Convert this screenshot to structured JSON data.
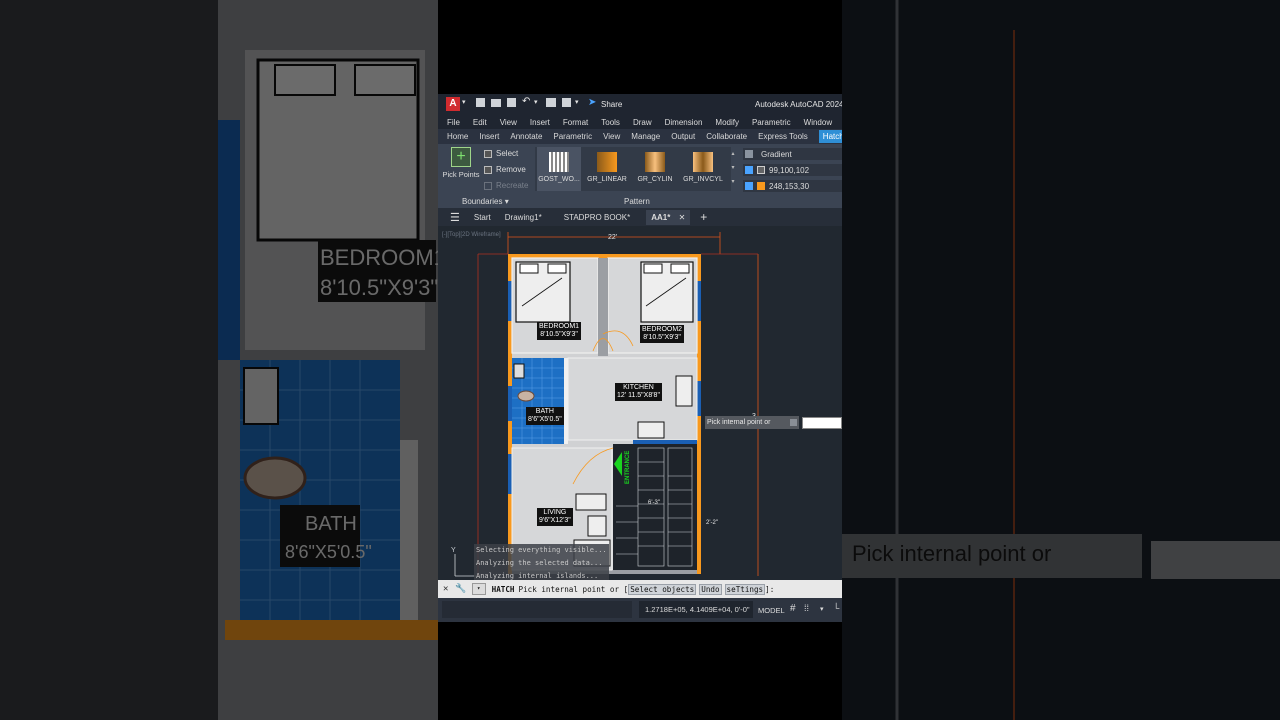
{
  "app": {
    "title": "Autodesk AutoCAD 2024",
    "logo_letter": "A",
    "share_label": "Share"
  },
  "menu": [
    "File",
    "Edit",
    "View",
    "Insert",
    "Format",
    "Tools",
    "Draw",
    "Dimension",
    "Modify",
    "Parametric",
    "Window"
  ],
  "ribbon_tabs": [
    "Home",
    "Insert",
    "Annotate",
    "Parametric",
    "View",
    "Manage",
    "Output",
    "Collaborate",
    "Express Tools"
  ],
  "ribbon_tab_active": "Hatch",
  "ribbon": {
    "pick_points": "Pick Points",
    "select": "Select",
    "remove": "Remove",
    "recreate": "Recreate",
    "boundaries": "Boundaries",
    "patterns": [
      "GOST_WO...",
      "GR_LINEAR",
      "GR_CYLIN",
      "GR_INVCYL"
    ],
    "pattern_label": "Pattern",
    "gradient": "Gradient",
    "color1": "99,100,102",
    "color2": "248,153,30"
  },
  "doc_tabs": [
    "Start",
    "Drawing1*",
    "STADPRO BOOK*",
    "AA1*"
  ],
  "viewport_label": "[-][Top][2D Wireframe]",
  "plan": {
    "width_dim": "22'",
    "rooms": [
      {
        "name": "BEDROOM1",
        "size": "8'10.5\"X9'3\""
      },
      {
        "name": "BEDROOM2",
        "size": "8'10.5\"X9'3\""
      },
      {
        "name": "KITCHEN",
        "size": "12' 11.5\"X8'8\""
      },
      {
        "name": "BATH",
        "size": "8'6\"X5'0.5\""
      },
      {
        "name": "LIVING",
        "size": "9'6\"X12'3\""
      }
    ],
    "entrance": "ENTRANCE",
    "stair_dim": "6'-3\"",
    "side_dim": "2'-2\"",
    "height_dim": "3"
  },
  "tooltip": "Pick internal point or",
  "history": [
    "Selecting everything visible...",
    "Analyzing the selected data...",
    "Analyzing internal islands..."
  ],
  "command": {
    "name": "HATCH",
    "prompt": "Pick internal point or [",
    "options": [
      "Select objects",
      "Undo",
      "seTtings"
    ],
    "suffix": "]:"
  },
  "status": {
    "coords": "1.2718E+05, 4.1409E+04, 0'-0\"",
    "model": "MODEL"
  },
  "colors": {
    "blue_wall": "#1a5fb4",
    "orange": "#f8991e",
    "gray": "#636466"
  }
}
